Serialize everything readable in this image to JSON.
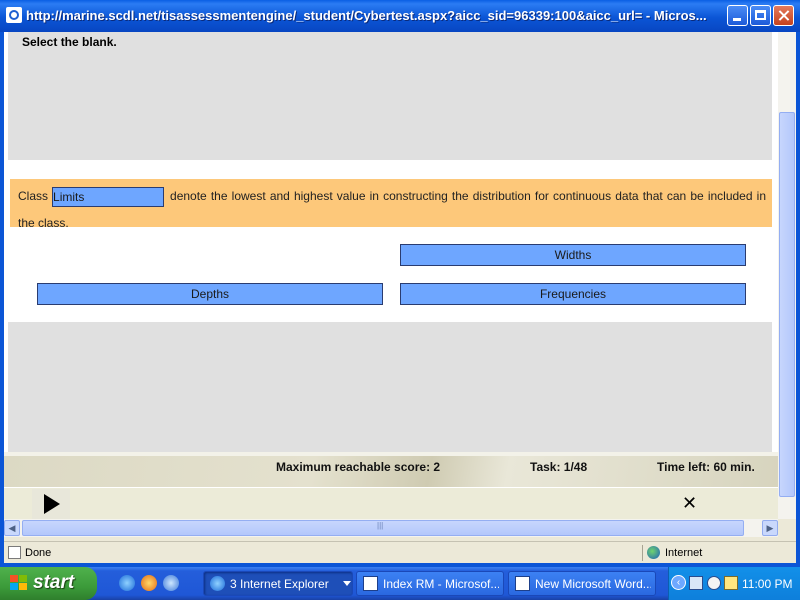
{
  "window": {
    "title": "http://marine.scdl.net/tisassessmentengine/_student/Cybertest.aspx?aicc_sid=96339:100&aicc_url= - Micros..."
  },
  "question": {
    "prompt": "Select the blank.",
    "sentence_before": "Class",
    "blank_value": "Limits",
    "sentence_after": "denote the lowest and highest value in constructing the distribution for continuous data that can be included  in the class."
  },
  "options": [
    {
      "label": "Widths"
    },
    {
      "label": "Depths"
    },
    {
      "label": "Frequencies"
    }
  ],
  "footer": {
    "score": "Maximum reachable score: 2",
    "task": "Task: 1/48",
    "time_left": "Time left: 60 min."
  },
  "statusbar": {
    "status": "Done",
    "zone": "Internet"
  },
  "taskbar": {
    "start_label": "start",
    "buttons": [
      {
        "label": "3 Internet Explorer",
        "icon": "ie-icon"
      },
      {
        "label": "Index RM - Microsof...",
        "icon": "word-icon"
      },
      {
        "label": "New Microsoft Word...",
        "icon": "word-icon"
      }
    ],
    "clock": "11:00 PM"
  },
  "colors": {
    "option_fill": "#6ea6ff",
    "sentence_band": "#fdc87a",
    "question_band": "#e0e0e0",
    "xp_blue": "#0b55d6",
    "start_green": "#3c9b3a"
  }
}
